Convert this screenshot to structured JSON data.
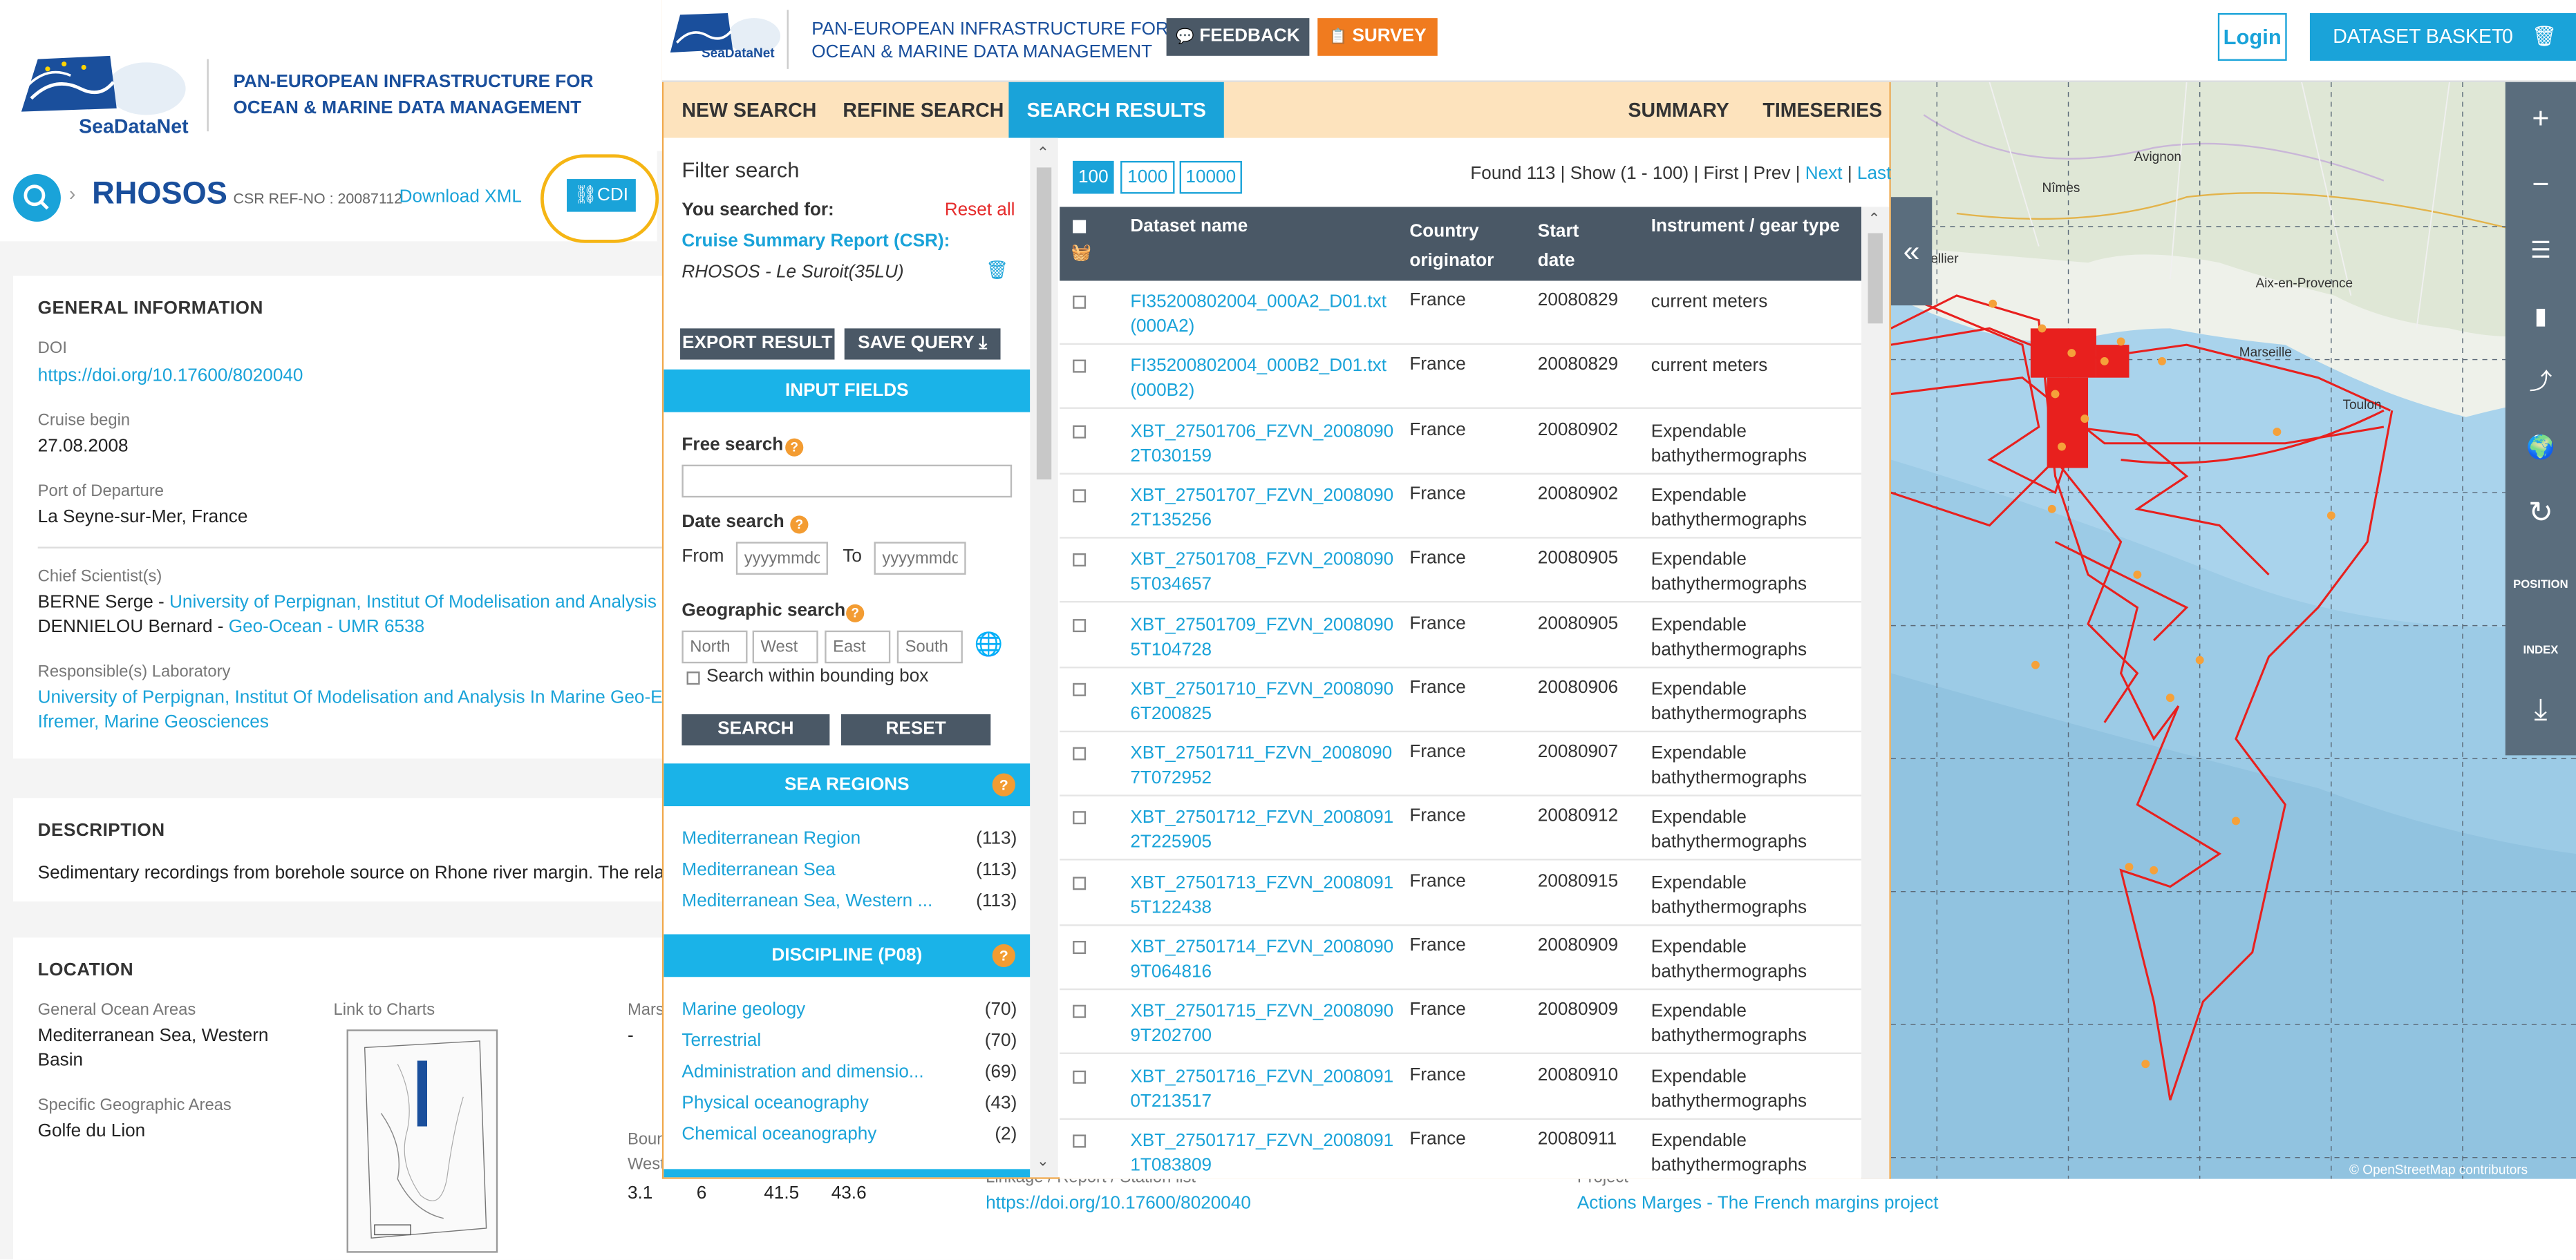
{
  "bg": {
    "org_line1": "PAN-EUROPEAN INFRASTRUCTURE FOR",
    "org_line2": "OCEAN & MARINE DATA MANAGEMENT",
    "logo_text": "SeaDataNet",
    "cruise_name": "RHOSOS",
    "csr_ref": "CSR REF-NO : 20087112",
    "download_xml": "Download XML",
    "cdi": "CDI",
    "general_info": "GENERAL INFORMATION",
    "doi_label": "DOI",
    "doi_value": "https://doi.org/10.17600/8020040",
    "cruise_begin_label": "Cruise begin",
    "cruise_begin_value": "27.08.2008",
    "port_label": "Port of Departure",
    "port_value": "La Seyne-sur-Mer, France",
    "chief_label": "Chief Scientist(s)",
    "chief1_name": "BERNE Serge - ",
    "chief1_org": "University of Perpignan, Institut Of Modelisation and Analysis In M",
    "chief2_name": "DENNIELOU Bernard - ",
    "chief2_org": "Geo-Ocean - UMR 6538",
    "lab_label": "Responsible(s) Laboratory",
    "lab1": "University of Perpignan, Institut Of Modelisation and Analysis In Marine Geo-Env",
    "lab2": "Ifremer, Marine Geosciences",
    "description_title": "DESCRIPTION",
    "description_text": "Sedimentary recordings from borehole source on Rhone river margin. The relat",
    "location_title": "LOCATION",
    "goa_label": "General Ocean Areas",
    "goa_value_1": "Mediterranean Sea, Western",
    "goa_value_2": "Basin",
    "charts_label": "Link to Charts",
    "mars_label": "Mars",
    "mars_value": "-",
    "sga_label": "Specific Geographic Areas",
    "sga_value": "Golfe du Lion",
    "bound_label": "Boun",
    "west_label": "West",
    "bound_values": [
      "3.1",
      "6",
      "41.5",
      "43.6"
    ],
    "linkage_label": "Linkage / Report / Station list",
    "linkage_value": "https://doi.org/10.17600/8020040",
    "project_label": "Project",
    "project_value": "Actions Marges - The French margins project"
  },
  "topbar": {
    "org_line1": "PAN-EUROPEAN INFRASTRUCTURE FOR",
    "org_line2": "OCEAN & MARINE DATA MANAGEMENT",
    "logo_text": "SeaDataNet",
    "feedback": "FEEDBACK",
    "survey": "SURVEY",
    "login": "Login",
    "basket": "DATASET BASKET",
    "basket_count": "0"
  },
  "tabs": {
    "new_search": "NEW SEARCH",
    "refine_search": "REFINE SEARCH",
    "search_results": "SEARCH RESULTS",
    "summary": "SUMMARY",
    "timeseries": "TIMESERIES"
  },
  "filter": {
    "title": "Filter search",
    "you_searched": "You searched for:",
    "reset_all": "Reset all",
    "csr_label": "Cruise Summary Report (CSR):",
    "csr_value": "RHOSOS - Le Suroit(35LU)",
    "export": "EXPORT RESULT",
    "save_query": "SAVE QUERY",
    "input_fields": "INPUT FIELDS",
    "free_search": "Free search",
    "date_search": "Date search",
    "from": "From",
    "to": "To",
    "date_placeholder": "yyyymmdd",
    "geo_search": "Geographic search",
    "north": "North",
    "west": "West",
    "east": "East",
    "south": "South",
    "within_box": "Search within bounding box",
    "search_btn": "SEARCH",
    "reset_btn": "RESET",
    "sea_regions": "SEA REGIONS",
    "regions": [
      {
        "name": "Mediterranean Region",
        "count": "(113)"
      },
      {
        "name": "Mediterranean Sea",
        "count": "(113)"
      },
      {
        "name": "Mediterranean Sea, Western ...",
        "count": "(113)"
      }
    ],
    "discipline": "DISCIPLINE (P08)",
    "disciplines": [
      {
        "name": "Marine geology",
        "count": "(70)"
      },
      {
        "name": "Terrestrial",
        "count": "(70)"
      },
      {
        "name": "Administration and dimensio...",
        "count": "(69)"
      },
      {
        "name": "Physical oceanography",
        "count": "(43)"
      },
      {
        "name": "Chemical oceanography",
        "count": "(2)"
      }
    ]
  },
  "results": {
    "pages": [
      "100",
      "1000",
      "10000"
    ],
    "found_text": "Found 113 | Show (1 - 100) | First | Prev | ",
    "next": "Next",
    "sep": " | ",
    "last": "Last",
    "headers": {
      "name": "Dataset name",
      "country_1": "Country",
      "country_2": "originator",
      "date_1": "Start",
      "date_2": "date",
      "instrument": "Instrument / gear type"
    },
    "rows": [
      {
        "name": "FI35200802004_000A2_D01.txt(000A2)",
        "country": "France",
        "date": "20080829",
        "instrument": "current meters"
      },
      {
        "name": "FI35200802004_000B2_D01.txt(000B2)",
        "country": "France",
        "date": "20080829",
        "instrument": "current meters"
      },
      {
        "name": "XBT_27501706_FZVN_20080902T030159",
        "country": "France",
        "date": "20080902",
        "instrument": "Expendable bathythermographs"
      },
      {
        "name": "XBT_27501707_FZVN_20080902T135256",
        "country": "France",
        "date": "20080902",
        "instrument": "Expendable bathythermographs"
      },
      {
        "name": "XBT_27501708_FZVN_20080905T034657",
        "country": "France",
        "date": "20080905",
        "instrument": "Expendable bathythermographs"
      },
      {
        "name": "XBT_27501709_FZVN_20080905T104728",
        "country": "France",
        "date": "20080905",
        "instrument": "Expendable bathythermographs"
      },
      {
        "name": "XBT_27501710_FZVN_20080906T200825",
        "country": "France",
        "date": "20080906",
        "instrument": "Expendable bathythermographs"
      },
      {
        "name": "XBT_27501711_FZVN_20080907T072952",
        "country": "France",
        "date": "20080907",
        "instrument": "Expendable bathythermographs"
      },
      {
        "name": "XBT_27501712_FZVN_20080912T225905",
        "country": "France",
        "date": "20080912",
        "instrument": "Expendable bathythermographs"
      },
      {
        "name": "XBT_27501713_FZVN_20080915T122438",
        "country": "France",
        "date": "20080915",
        "instrument": "Expendable bathythermographs"
      },
      {
        "name": "XBT_27501714_FZVN_20080909T064816",
        "country": "France",
        "date": "20080909",
        "instrument": "Expendable bathythermographs"
      },
      {
        "name": "XBT_27501715_FZVN_20080909T202700",
        "country": "France",
        "date": "20080909",
        "instrument": "Expendable bathythermographs"
      },
      {
        "name": "XBT_27501716_FZVN_20080910T213517",
        "country": "France",
        "date": "20080910",
        "instrument": "Expendable bathythermographs"
      },
      {
        "name": "XBT_27501717_FZVN_20080911T083809",
        "country": "France",
        "date": "20080911",
        "instrument": "Expendable bathythermographs"
      }
    ]
  },
  "map": {
    "cities": [
      "Nîmes",
      "Avignon",
      "Montpellier",
      "Aix-en-Provence",
      "Marseille",
      "Toulon"
    ],
    "attribution": "© OpenStreetMap contributors",
    "position": "POSITION",
    "index": "INDEX"
  },
  "colors": {
    "accent": "#1aa3d9",
    "tabs_bg": "#fde3bd",
    "survey": "#f07b1f",
    "dark": "#4a5866",
    "track": "#e8201e"
  }
}
